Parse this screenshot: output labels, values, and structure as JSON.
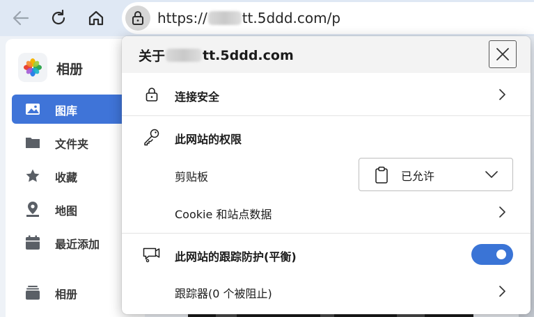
{
  "browser": {
    "back_label": "←",
    "url_prefix": "https://",
    "url_suffix": "tt.5ddd.com/p"
  },
  "webpage": {
    "app_title": "相册",
    "nav_items": [
      {
        "label": "图库",
        "icon": "image-icon",
        "active": true
      },
      {
        "label": "文件夹",
        "icon": "folder-icon",
        "active": false
      },
      {
        "label": "收藏",
        "icon": "star-icon",
        "active": false
      },
      {
        "label": "地图",
        "icon": "map-pin-icon",
        "active": false
      },
      {
        "label": "最近添加",
        "icon": "calendar-icon",
        "active": false
      },
      {
        "label": "相册",
        "icon": "albums-icon",
        "active": false
      }
    ],
    "colors": {
      "accent": "#3f74d8"
    }
  },
  "flyout": {
    "title_prefix": "关于",
    "title_suffix": "tt.5ddd.com",
    "connection_label": "连接安全",
    "permissions_heading": "此网站的权限",
    "clipboard_label": "剪贴板",
    "clipboard_value": "已允许",
    "cookie_label": "Cookie 和站点数据",
    "tracking_label": "此网站的跟踪防护(平衡)",
    "tracking_enabled": true,
    "trackers_label": "跟踪器(0 个被阻止)",
    "colors": {
      "toggle": "#3a74d6",
      "header_bg": "#f3f3f3"
    }
  }
}
